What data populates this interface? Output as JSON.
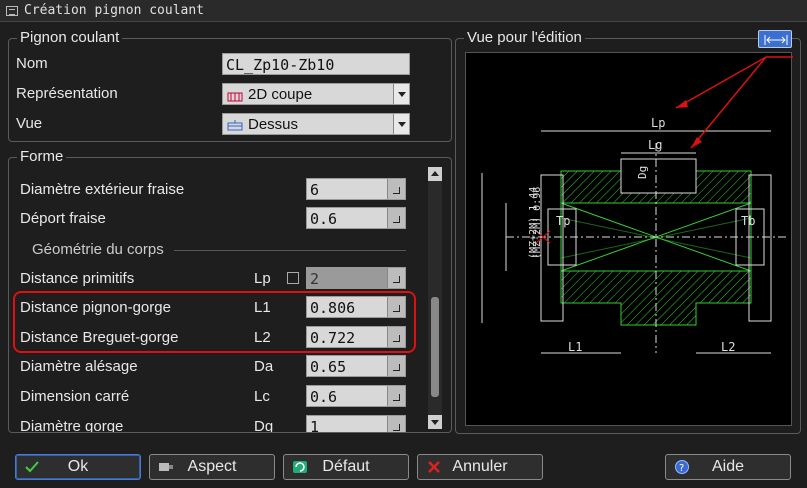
{
  "window": {
    "title": "Création pignon coulant"
  },
  "pignon_group": {
    "title": "Pignon coulant",
    "nom_label": "Nom",
    "nom_value": "CL_Zp10-Zb10",
    "representation_label": "Représentation",
    "representation_value": "2D coupe",
    "vue_label": "Vue",
    "vue_value": "Dessus"
  },
  "forme_group": {
    "title": "Forme",
    "rows": [
      {
        "label": "Diamètre extérieur fraise",
        "symbol": "",
        "value": "6"
      },
      {
        "label": "Déport fraise",
        "symbol": "",
        "value": "0.6"
      },
      {
        "label": "Distance primitifs",
        "symbol": "Lp",
        "value": "2"
      },
      {
        "label": "Distance pignon-gorge",
        "symbol": "L1",
        "value": "0.806"
      },
      {
        "label": "Distance Breguet-gorge",
        "symbol": "L2",
        "value": "0.722"
      },
      {
        "label": "Diamètre alésage",
        "symbol": "Da",
        "value": "0.65"
      },
      {
        "label": "Dimension carré",
        "symbol": "Lc",
        "value": "0.6"
      },
      {
        "label": "Diamètre gorge",
        "symbol": "Dg",
        "value": "1"
      }
    ],
    "section_label": "Géométrie du corps"
  },
  "preview_group": {
    "title": "Vue pour l'édition",
    "labels": {
      "lp": "Lp",
      "lg": "Lg",
      "dg": "Dg",
      "tp": "Tp",
      "tb": "Tb",
      "l1": "L1",
      "l2": "L2",
      "dim1": "(MZ+2M) 1.44",
      "dim2": "(MZ-2M) 0.96"
    }
  },
  "buttons": {
    "ok": "Ok",
    "aspect": "Aspect",
    "defaut": "Défaut",
    "annuler": "Annuler",
    "aide": "Aide"
  },
  "colors": {
    "accent": "#3b6fd0",
    "highlight": "#d11111",
    "drawing": "#33cc33"
  }
}
